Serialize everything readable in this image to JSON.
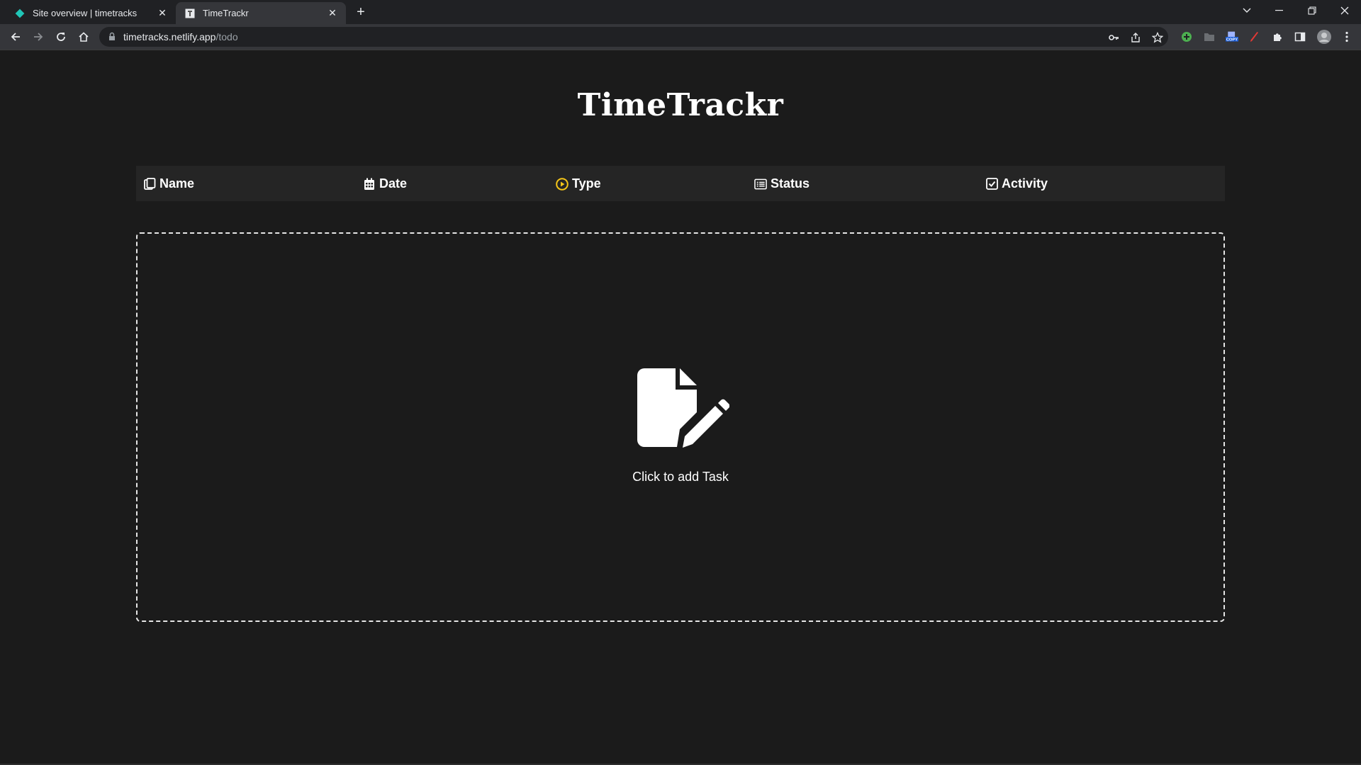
{
  "browser": {
    "tabs": [
      {
        "title": "Site overview | timetracks",
        "favicon": "netlify-diamond-icon",
        "active": false
      },
      {
        "title": "TimeTrackr",
        "favicon": "page-favicon",
        "active": true
      }
    ],
    "address": {
      "host": "timetracks.netlify.app",
      "path": "/todo"
    }
  },
  "app": {
    "title": "TimeTrackr",
    "columns": [
      {
        "label": "Name",
        "icon": "clipboard-icon"
      },
      {
        "label": "Date",
        "icon": "calendar-icon"
      },
      {
        "label": "Type",
        "icon": "play-circle-icon",
        "icon_color": "#f5c518"
      },
      {
        "label": "Status",
        "icon": "list-icon"
      },
      {
        "label": "Activity",
        "icon": "check-square-icon"
      }
    ],
    "empty_state": {
      "label": "Click to add Task",
      "icon": "file-edit-icon"
    }
  },
  "colors": {
    "background": "#1b1b1b",
    "header_bg": "#252525",
    "accent": "#f5c518",
    "text": "#ffffff"
  }
}
